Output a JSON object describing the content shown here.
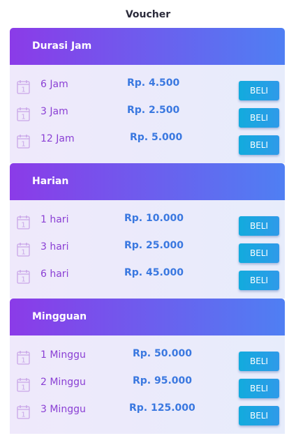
{
  "page": {
    "title": "Voucher"
  },
  "sections": [
    {
      "name": "Durasi Jam",
      "items": [
        {
          "duration": "6 Jam",
          "price": "Rp. 4.500",
          "button": "BELI"
        },
        {
          "duration": "3 Jam",
          "price": "Rp. 2.500",
          "button": "BELI"
        },
        {
          "duration": "12 Jam",
          "price": "Rp. 5.000",
          "button": "BELI"
        }
      ]
    },
    {
      "name": "Harian",
      "items": [
        {
          "duration": "1 hari",
          "price": "Rp. 10.000",
          "button": "BELI"
        },
        {
          "duration": "3 hari",
          "price": "Rp. 25.000",
          "button": "BELI"
        },
        {
          "duration": "6 hari",
          "price": "Rp. 45.000",
          "button": "BELI"
        }
      ]
    },
    {
      "name": "Mingguan",
      "items": [
        {
          "duration": "1 Minggu",
          "price": "Rp. 50.000",
          "button": "BELI"
        },
        {
          "duration": "2 Minggu",
          "price": "Rp. 95.000",
          "button": "BELI"
        },
        {
          "duration": "3 Minggu",
          "price": "Rp. 125.000",
          "button": "BELI"
        }
      ]
    }
  ],
  "icons": {
    "item_icon": "calendar-icon",
    "calendar_day": "1"
  },
  "colors": {
    "header_gradient_start": "#8b3be8",
    "header_gradient_end": "#4f7ff3",
    "duration_text": "#8a3fd4",
    "price_text": "#3a78e0",
    "button": "#12abdd"
  }
}
